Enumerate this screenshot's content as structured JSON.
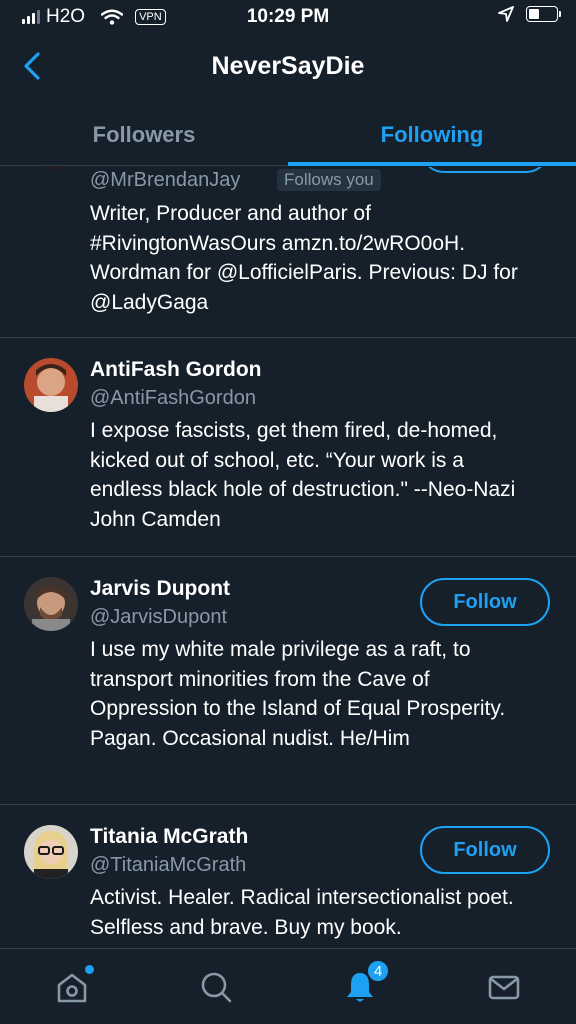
{
  "status_bar": {
    "carrier": "H2O",
    "vpn": "VPN",
    "time": "10:29 PM"
  },
  "header": {
    "title": "NeverSayDie"
  },
  "tabs": [
    {
      "label": "Followers",
      "active": false
    },
    {
      "label": "Following",
      "active": true
    }
  ],
  "follow_label": "Follow",
  "users": [
    {
      "name": "",
      "handle": "@MrBrendanJay",
      "follows_you": "Follows you",
      "bio": "Writer, Producer and author of #RivingtonWasOurs amzn.to/2wRO0oH. Wordman for @LofficielParis. Previous: DJ for @LadyGaga"
    },
    {
      "name": "AntiFash Gordon",
      "handle": "@AntiFashGordon",
      "bio": "I expose fascists, get them fired, de-homed, kicked out of school, etc. “Your work is a endless black hole of destruction.\" --Neo-Nazi John Camden"
    },
    {
      "name": "Jarvis Dupont",
      "handle": "@JarvisDupont",
      "bio": "I use my white male privilege as a raft, to transport minorities from the Cave of Oppression to the Island of Equal Prosperity. Pagan. Occasional nudist. He/Him"
    },
    {
      "name": "Titania McGrath",
      "handle": "@TitaniaMcGrath",
      "bio": "Activist. Healer. Radical intersectionalist poet. Selfless and brave. Buy my book."
    }
  ],
  "tab_bar": {
    "notifications_badge": "4"
  },
  "colors": {
    "background": "#15202b",
    "accent": "#1da1f2",
    "secondary_text": "#8899a6",
    "divider": "#2f3b47"
  }
}
